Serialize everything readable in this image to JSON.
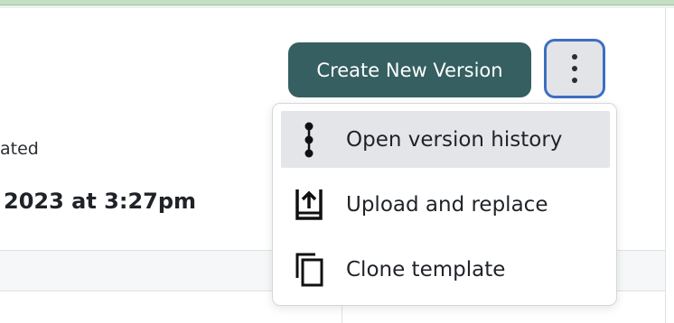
{
  "version_info": {
    "label_fragment": "ated",
    "value_fragment": "2023 at 3:27pm"
  },
  "actions": {
    "create_new_version_label": "Create New Version",
    "more_options_icon": "kebab-vertical-icon"
  },
  "menu": {
    "items": [
      {
        "label": "Open version history",
        "icon": "timeline-icon",
        "highlighted": true
      },
      {
        "label": "Upload and replace",
        "icon": "upload-tray-icon",
        "highlighted": false
      },
      {
        "label": "Clone template",
        "icon": "copy-icon",
        "highlighted": false
      }
    ]
  },
  "colors": {
    "primary_button": "#355f61",
    "focus_ring": "#3f6ec2",
    "menu_highlight": "#e4e5e9",
    "top_accent": "#c5dfc3"
  }
}
